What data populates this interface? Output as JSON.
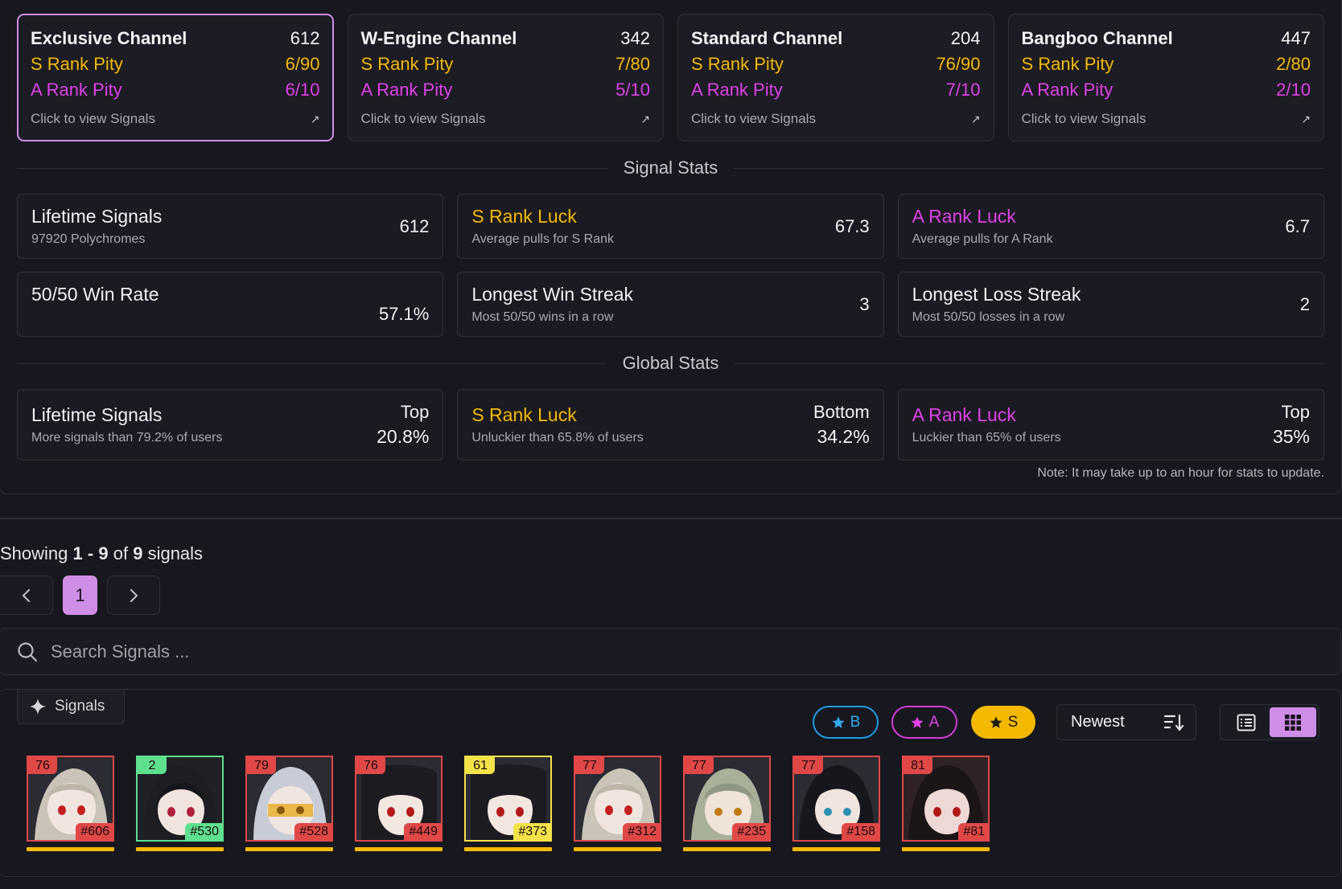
{
  "channels": [
    {
      "name": "Exclusive Channel",
      "count": "612",
      "s_label": "S Rank Pity",
      "s_value": "6/90",
      "a_label": "A Rank Pity",
      "a_value": "6/10",
      "link": "Click to view Signals",
      "active": true
    },
    {
      "name": "W-Engine Channel",
      "count": "342",
      "s_label": "S Rank Pity",
      "s_value": "7/80",
      "a_label": "A Rank Pity",
      "a_value": "5/10",
      "link": "Click to view Signals",
      "active": false
    },
    {
      "name": "Standard Channel",
      "count": "204",
      "s_label": "S Rank Pity",
      "s_value": "76/90",
      "a_label": "A Rank Pity",
      "a_value": "7/10",
      "link": "Click to view Signals",
      "active": false
    },
    {
      "name": "Bangboo Channel",
      "count": "447",
      "s_label": "S Rank Pity",
      "s_value": "2/80",
      "a_label": "A Rank Pity",
      "a_value": "2/10",
      "link": "Click to view Signals",
      "active": false
    }
  ],
  "signal_stats": {
    "title": "Signal Stats",
    "cards": [
      {
        "title": "Lifetime Signals",
        "sub": "97920 Polychromes",
        "value": "612"
      },
      {
        "title": "S Rank Luck",
        "sub": "Average pulls for S Rank",
        "value": "67.3"
      },
      {
        "title": "A Rank Luck",
        "sub": "Average pulls for A Rank",
        "value": "6.7"
      },
      {
        "title": "50/50 Win Rate",
        "sub": "",
        "value": "57.1%"
      },
      {
        "title": "Longest Win Streak",
        "sub": "Most 50/50 wins in a row",
        "value": "3"
      },
      {
        "title": "Longest Loss Streak",
        "sub": "Most 50/50 losses in a row",
        "value": "2"
      }
    ]
  },
  "global_stats": {
    "title": "Global Stats",
    "cards": [
      {
        "title": "Lifetime Signals",
        "sub": "More signals than 79.2% of users",
        "rank": "Top",
        "pct": "20.8%"
      },
      {
        "title": "S Rank Luck",
        "sub": "Unluckier than 65.8% of users",
        "rank": "Bottom",
        "pct": "34.2%"
      },
      {
        "title": "A Rank Luck",
        "sub": "Luckier than 65% of users",
        "rank": "Top",
        "pct": "35%"
      }
    ],
    "note": "Note: It may take up to an hour for stats to update."
  },
  "pagination": {
    "showing_prefix": "Showing",
    "range_start": "1",
    "range_sep": "-",
    "range_end": "9",
    "of": "of",
    "total": "9",
    "suffix": "signals",
    "current_page": "1"
  },
  "search": {
    "placeholder": "Search Signals ..."
  },
  "signals": {
    "tab_label": "Signals",
    "filters": {
      "b": "B",
      "a": "A",
      "s": "S"
    },
    "sort_label": "Newest",
    "items": [
      {
        "pity": "76",
        "number": "#606",
        "tone": "r"
      },
      {
        "pity": "2",
        "number": "#530",
        "tone": "b"
      },
      {
        "pity": "79",
        "number": "#528",
        "tone": "r"
      },
      {
        "pity": "76",
        "number": "#449",
        "tone": "r"
      },
      {
        "pity": "61",
        "number": "#373",
        "tone": "y"
      },
      {
        "pity": "77",
        "number": "#312",
        "tone": "r"
      },
      {
        "pity": "77",
        "number": "#235",
        "tone": "r"
      },
      {
        "pity": "77",
        "number": "#158",
        "tone": "r"
      },
      {
        "pity": "81",
        "number": "#81",
        "tone": "r"
      }
    ]
  },
  "colors": {
    "accent": "#cf8ee6",
    "s_rank": "#f5b800",
    "a_rank": "#e040e6",
    "b_rank": "#1e9be6",
    "loss": "#e04848"
  }
}
